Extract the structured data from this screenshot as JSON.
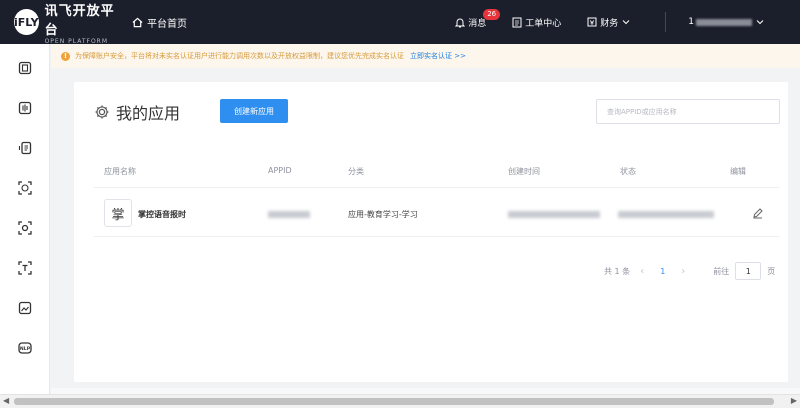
{
  "header": {
    "logo_mark": "iFLY",
    "logo_title": "讯飞开放平台",
    "logo_sub": "OPEN PLATFORM",
    "home_label": "平台首页",
    "messages_label": "消息",
    "messages_badge": "26",
    "tickets_label": "工单中心",
    "finance_label": "财务",
    "user_prefix": "1"
  },
  "sidebar": {
    "icons": [
      "console-icon",
      "voice-icon",
      "transcribe-icon",
      "face-icon",
      "scan-icon",
      "ocr-icon",
      "image-icon",
      "nlp-icon"
    ]
  },
  "notice": {
    "text": "为保障账户安全，平台将对未实名认证用户进行能力调用次数以及开放权益限制，建议您优先完成实名认证",
    "link": "立即实名认证 >>"
  },
  "main": {
    "title": "我的应用",
    "create_button": "创建新应用",
    "search_placeholder": "查询APPID或应用名称",
    "table": {
      "headers": [
        "应用名称",
        "APPID",
        "分类",
        "创建时间",
        "状态",
        "编辑"
      ],
      "rows": [
        {
          "badge": "掌",
          "name": "掌控语音报时",
          "category": "应用-教育学习-学习"
        }
      ]
    },
    "pagination": {
      "total": "共 1 条",
      "prev": "‹",
      "current": "1",
      "next": "›",
      "goto_label": "前往",
      "goto_value": "1",
      "page_suffix": "页"
    }
  },
  "colors": {
    "topbar": "#1b1e2b",
    "accent": "#2e8ff0",
    "notice_bg": "#fdf6ec",
    "notice_text": "#d69a3a",
    "badge": "#e5343a"
  }
}
